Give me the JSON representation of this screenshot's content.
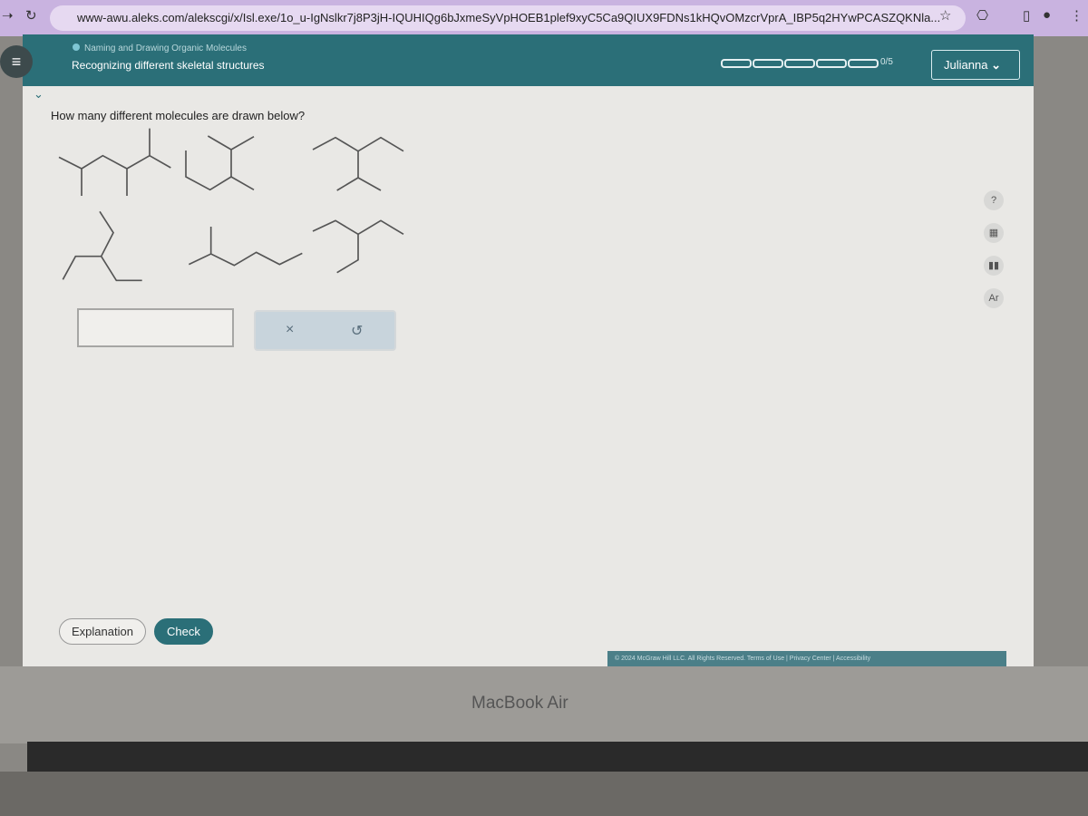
{
  "browser": {
    "url": "www-awu.aleks.com/alekscgi/x/Isl.exe/1o_u-IgNslkr7j8P3jH-IQUHIQg6bJxmeSyVpHOEB1plef9xyC5Ca9QIUX9FDNs1kHQvOMzcrVprA_IBP5q2HYwPCASZQKNla..."
  },
  "header": {
    "topic": "Naming and Drawing Organic Molecules",
    "title": "Recognizing different skeletal structures",
    "progress": "0/5",
    "progress_fraction": 0,
    "user": "Julianna"
  },
  "question": {
    "prompt": "How many different molecules are drawn below?",
    "answer_value": "",
    "clear_icon": "×",
    "undo_icon": "↺"
  },
  "side_tools": [
    "help-icon",
    "calculator-icon",
    "chart-icon",
    "periodic-table-icon"
  ],
  "side_labels": {
    "help": "?",
    "periodic": "Ar"
  },
  "buttons": {
    "explanation": "Explanation",
    "check": "Check"
  },
  "footer": "© 2024 McGraw Hill LLC. All Rights Reserved.   Terms of Use  |  Privacy Center  |  Accessibility",
  "device": "MacBook Air"
}
